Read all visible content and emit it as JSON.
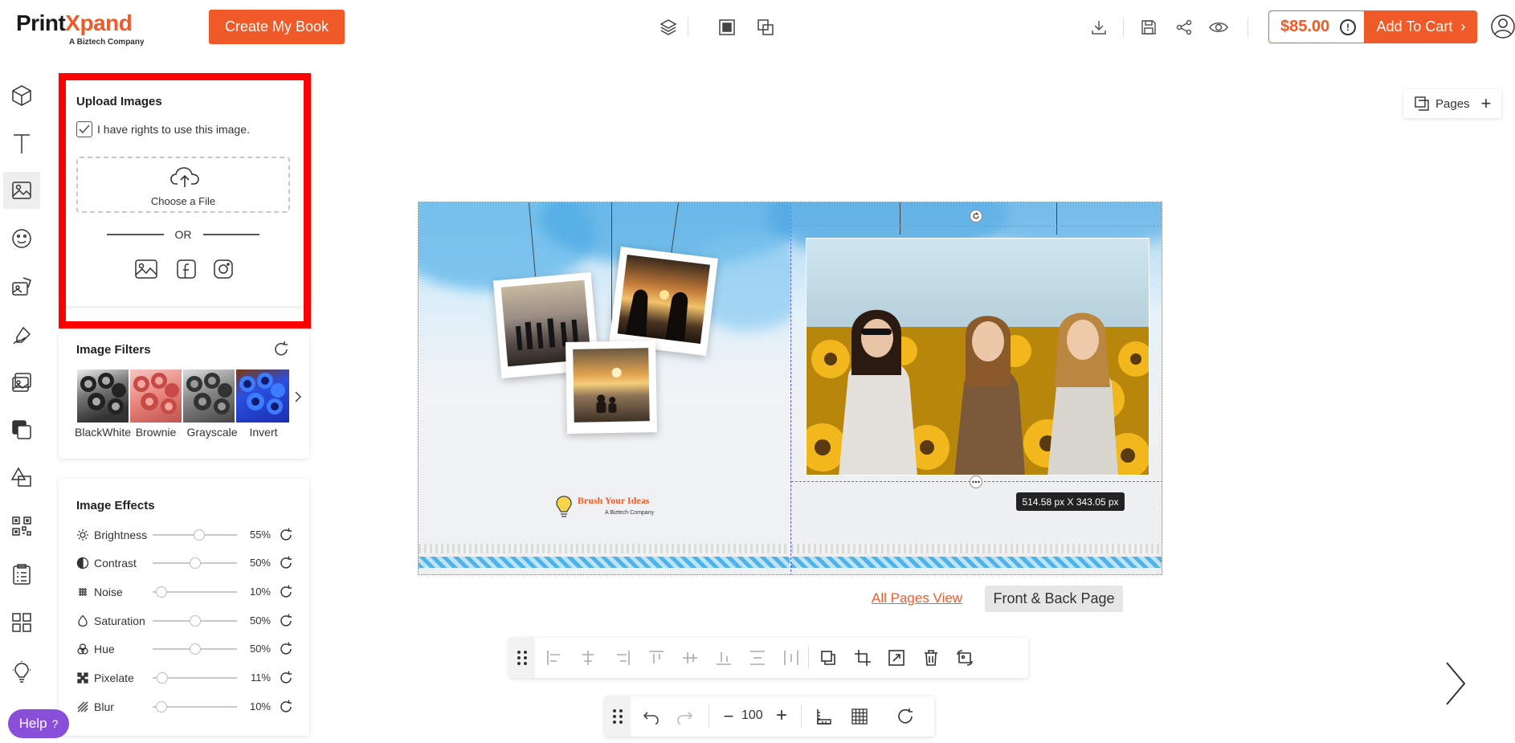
{
  "header": {
    "logo_main": "Print",
    "logo_accent": "Xpand",
    "logo_sub": "A Biztech Company",
    "create_button": "Create My Book",
    "price": "$85.00",
    "price_info": "!",
    "add_to_cart": "Add To Cart",
    "add_to_cart_chevron": "›"
  },
  "left_tools": [
    "3d-box-icon",
    "text-icon",
    "image-icon",
    "emoji-icon",
    "clipart-icon",
    "draw-icon",
    "photos-icon",
    "background-icon",
    "shapes-icon",
    "qr-code-icon",
    "checklist-icon",
    "layouts-icon",
    "bulb-icon"
  ],
  "upload": {
    "title": "Upload Images",
    "rights_label": "I have rights to use this image.",
    "choose_file": "Choose a File",
    "or_text": "OR"
  },
  "filters": {
    "title": "Image Filters",
    "items": [
      "BlackWhite",
      "Brownie",
      "Grayscale",
      "Invert"
    ]
  },
  "effects": {
    "title": "Image Effects",
    "items": [
      {
        "name": "Brightness",
        "value": "55%",
        "level": 0.55
      },
      {
        "name": "Contrast",
        "value": "50%",
        "level": 0.5
      },
      {
        "name": "Noise",
        "value": "10%",
        "level": 0.1
      },
      {
        "name": "Saturation",
        "value": "50%",
        "level": 0.5
      },
      {
        "name": "Hue",
        "value": "50%",
        "level": 0.5
      },
      {
        "name": "Pixelate",
        "value": "11%",
        "level": 0.11
      },
      {
        "name": "Blur",
        "value": "10%",
        "level": 0.1
      }
    ]
  },
  "help": {
    "label": "Help",
    "mark": "?"
  },
  "canvas": {
    "brand_name": "Brush Your Ideas",
    "brand_tag": "A Biztech Company",
    "selection_dims": "514.58 px X 343.05 px"
  },
  "page_nav": {
    "all_pages": "All Pages View",
    "front_back": "Front & Back Page",
    "pages_label": "Pages",
    "pages_add": "+"
  },
  "zoom": {
    "minus": "−",
    "value": "100",
    "plus": "+"
  },
  "colors": {
    "accent": "#f05a28",
    "help": "#8a4fd8",
    "highlight": "#ff0000"
  }
}
